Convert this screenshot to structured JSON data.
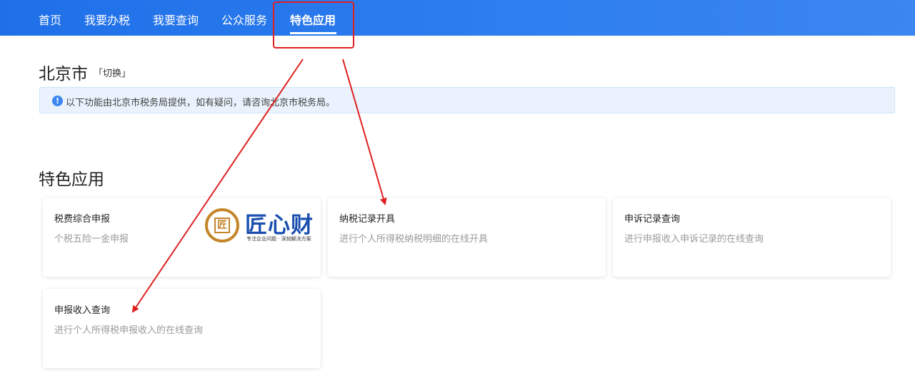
{
  "nav": {
    "items": [
      {
        "label": "首页"
      },
      {
        "label": "我要办税"
      },
      {
        "label": "我要查询"
      },
      {
        "label": "公众服务"
      },
      {
        "label": "特色应用"
      }
    ]
  },
  "city": {
    "name": "北京市",
    "switch_label": "「切换」"
  },
  "notice": {
    "icon": "info-icon",
    "icon_glyph": "!",
    "text": "以下功能由北京市税务局提供，如有疑问，请咨询北京市税务局。"
  },
  "section": {
    "title": "特色应用"
  },
  "cards": [
    {
      "title": "税费综合申报",
      "desc": "个税五险一金申报"
    },
    {
      "title": "纳税记录开具",
      "desc": "进行个人所得税纳税明细的在线开具"
    },
    {
      "title": "申诉记录查询",
      "desc": "进行申报收入申诉记录的在线查询"
    },
    {
      "title": "申报收入查询",
      "desc": "进行个人所得税申报收入的在线查询"
    }
  ],
  "watermark": {
    "brand": "匠心财",
    "glyph": "匠",
    "tagline": "专注企业问题 · 深刻解决方案"
  },
  "colors": {
    "topbar": "#2f7ff0",
    "annotation": "#e02020",
    "notice_bg": "#eaf3fd",
    "brand_blue": "#1a4fb0",
    "brand_gold": "#c5862a"
  }
}
